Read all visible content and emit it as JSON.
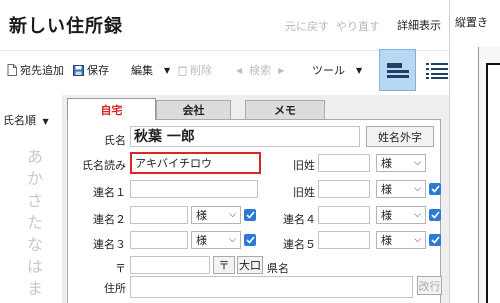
{
  "header": {
    "title": "新しい住所録",
    "undo_label": "元に戻す",
    "redo_label": "やり直す",
    "detail_label": "詳細表示"
  },
  "toolbar": {
    "add_label": "宛先追加",
    "save_label": "保存",
    "edit_label": "編集",
    "delete_label": "削除",
    "search_label": "検索",
    "tools_label": "ツール"
  },
  "left": {
    "sort_label": "氏名順",
    "kana": [
      "あ",
      "か",
      "さ",
      "た",
      "な",
      "は",
      "ま"
    ]
  },
  "tabs": {
    "home": "自宅",
    "company": "会社",
    "memo": "メモ"
  },
  "form": {
    "name_label": "氏名",
    "name_value": "秋葉 一郎",
    "name_ext_button": "姓名外字",
    "reading_label": "氏名読み",
    "reading_value": "アキバイチロウ",
    "old_surname_label_1": "旧姓",
    "old_surname_label_2": "旧姓",
    "joint1_label": "連名１",
    "joint2_label": "連名２",
    "joint3_label": "連名３",
    "joint4_label": "連名４",
    "joint5_label": "連名５",
    "honorific": "様",
    "postal_label": "〒",
    "postal_btn": "〒",
    "oguchi_btn": "大口",
    "pref_label": "県名",
    "address_label": "住所",
    "newline_btn": "改行"
  },
  "right": {
    "heading": "縦置き"
  },
  "colors": {
    "accent_active_tab": "#dd2222",
    "highlight_border": "#e02424",
    "checkbox": "#2d7ad6",
    "view_active": "#b7d7f3"
  }
}
